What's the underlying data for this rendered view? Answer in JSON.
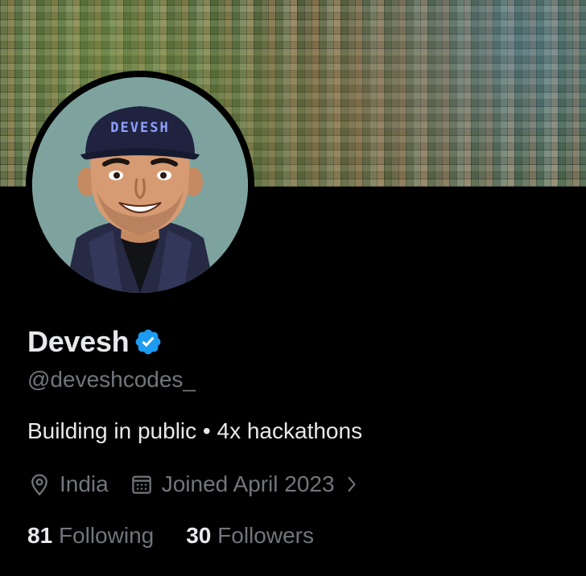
{
  "profile": {
    "display_name": "Devesh",
    "handle": "@deveshcodes_",
    "bio": "Building in public • 4x hackathons",
    "location": "India",
    "joined": "Joined April 2023",
    "verified_icon": "verified-badge-icon",
    "avatar_cap_text": "DEVESH"
  },
  "stats": {
    "following_count": "81",
    "following_label": "Following",
    "followers_count": "30",
    "followers_label": "Followers"
  },
  "colors": {
    "background": "#000000",
    "primary_text": "#e7e9ea",
    "secondary_text": "#71767b",
    "verified_blue": "#1d9bf0"
  },
  "icons": {
    "location": "location-pin-icon",
    "calendar": "calendar-icon",
    "chevron": "chevron-right-icon"
  }
}
